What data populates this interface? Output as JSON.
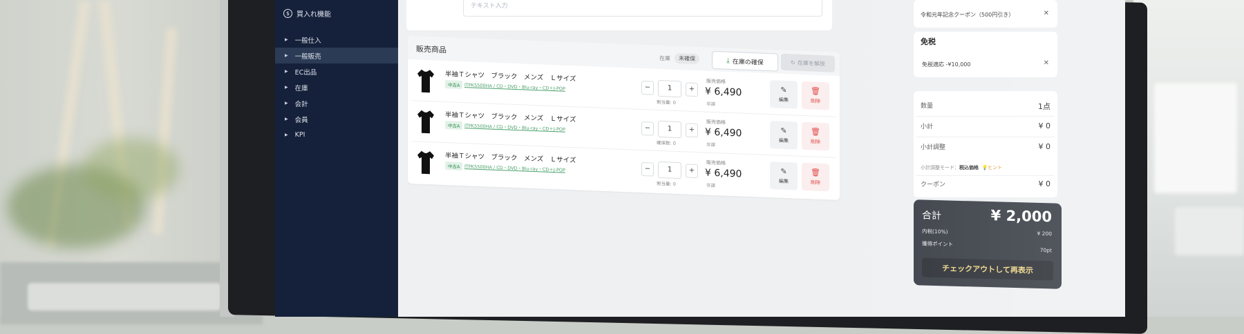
{
  "sidebar": {
    "top_item": {
      "label": "買入れ機能",
      "icon": "coin-icon"
    },
    "items": [
      {
        "label": "一般仕入",
        "active": false
      },
      {
        "label": "一般販売",
        "active": true
      },
      {
        "label": "EC出品",
        "active": false
      },
      {
        "label": "在庫",
        "active": false
      },
      {
        "label": "会計",
        "active": false
      },
      {
        "label": "会員",
        "active": false
      },
      {
        "label": "KPI",
        "active": false
      }
    ]
  },
  "top_input": {
    "placeholder": "テキスト入力"
  },
  "sales": {
    "title": "販売商品",
    "stock_label": "在庫",
    "stock_status": "未確保",
    "reserve_button": "在庫の確保",
    "release_button": "在庫を解放",
    "items": [
      {
        "name": "半袖Ｔシャツ　ブラック　メンズ　Ｌサイズ",
        "tag": "中古A",
        "code": "ITPK5500HA / CD・DVD・Blu-ray・CD＋J-POP",
        "qty": "1",
        "alloc": "割当量: 0",
        "price_label": "販売価格",
        "price": "¥ 6,490",
        "tax_note": "非課",
        "edit_label": "編集",
        "delete_label": "削除"
      },
      {
        "name": "半袖Ｔシャツ　ブラック　メンズ　Ｌサイズ",
        "tag": "中古A",
        "code": "ITPK5500HA / CD・DVD・Blu-ray・CD＋J-POP",
        "qty": "1",
        "alloc": "確保数: 0",
        "price_label": "販売価格",
        "price": "¥ 6,490",
        "tax_note": "非課",
        "edit_label": "編集",
        "delete_label": "削除"
      },
      {
        "name": "半袖Ｔシャツ　ブラック　メンズ　Ｌサイズ",
        "tag": "中古A",
        "code": "ITPK5500HA / CD・DVD・Blu-ray・CD＋J-POP",
        "qty": "1",
        "alloc": "割当量: 0",
        "price_label": "販売価格",
        "price": "¥ 6,490",
        "tax_note": "非課",
        "edit_label": "編集",
        "delete_label": "削除"
      }
    ]
  },
  "summary": {
    "coupon": "令和元年記念クーポン（500円引き）",
    "duty_free": {
      "title": "免税",
      "line": "免税適応 -¥10,000"
    },
    "totals": {
      "count_label": "数量",
      "count_value": "1点",
      "subtotal_label": "小計",
      "subtotal_value": "¥ 0",
      "adjust_label": "小計調整",
      "adjust_value": "¥ 0",
      "mode_label": "小計調整モード：",
      "mode_value": "税込価格",
      "hint": "ヒント",
      "coupon_label": "クーポン",
      "coupon_value": "¥ 0"
    },
    "total": {
      "label": "合計",
      "value": "¥ 2,000",
      "tax_label": "内税(10%)",
      "tax_value": "¥ 200",
      "points_label": "獲得ポイント",
      "points_value": "70pt",
      "checkout_button": "チェックアウトして再表示"
    }
  },
  "colors": {
    "sidebar_bg": "#15203a",
    "accent_green": "#2e9a55",
    "delete_red": "#e04848",
    "checkout_text": "#f1d789"
  }
}
